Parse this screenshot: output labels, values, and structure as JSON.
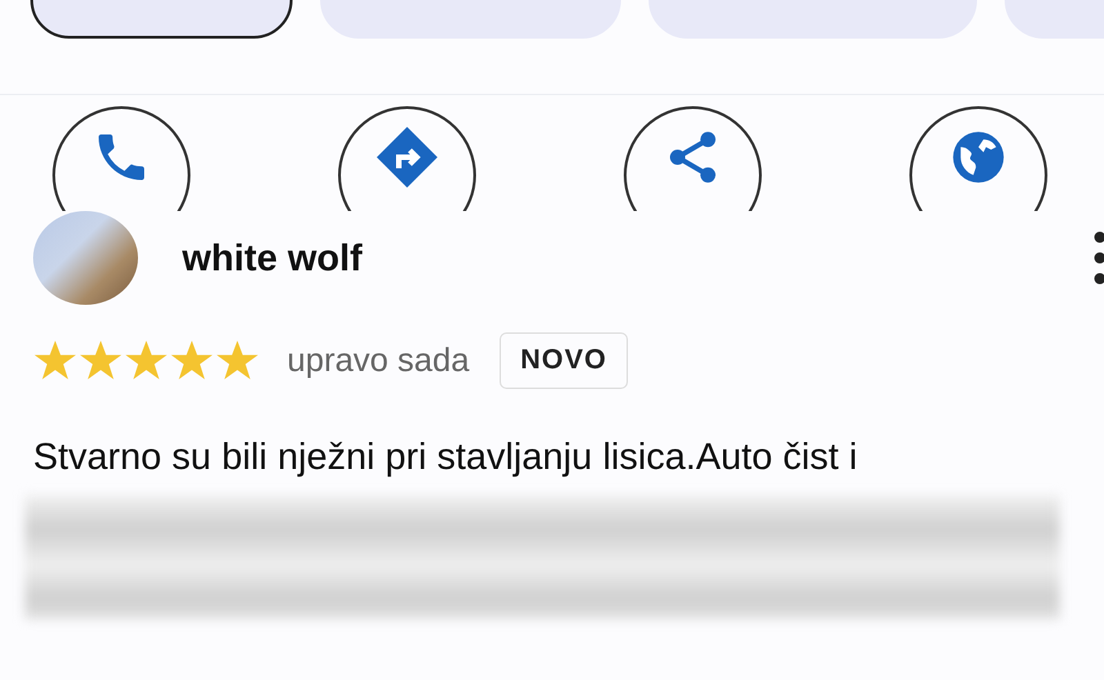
{
  "tabs": [
    {
      "selected": true
    },
    {
      "selected": false
    },
    {
      "selected": false
    },
    {
      "selected": false
    }
  ],
  "actions": [
    {
      "kind": "call"
    },
    {
      "kind": "directions"
    },
    {
      "kind": "share"
    },
    {
      "kind": "website"
    }
  ],
  "review": {
    "author": "white wolf",
    "stars": 5,
    "time": "upravo sada",
    "badge": "NOVO",
    "text": "Stvarno su bili nježni pri stavljanju lisica.Auto čist i"
  }
}
